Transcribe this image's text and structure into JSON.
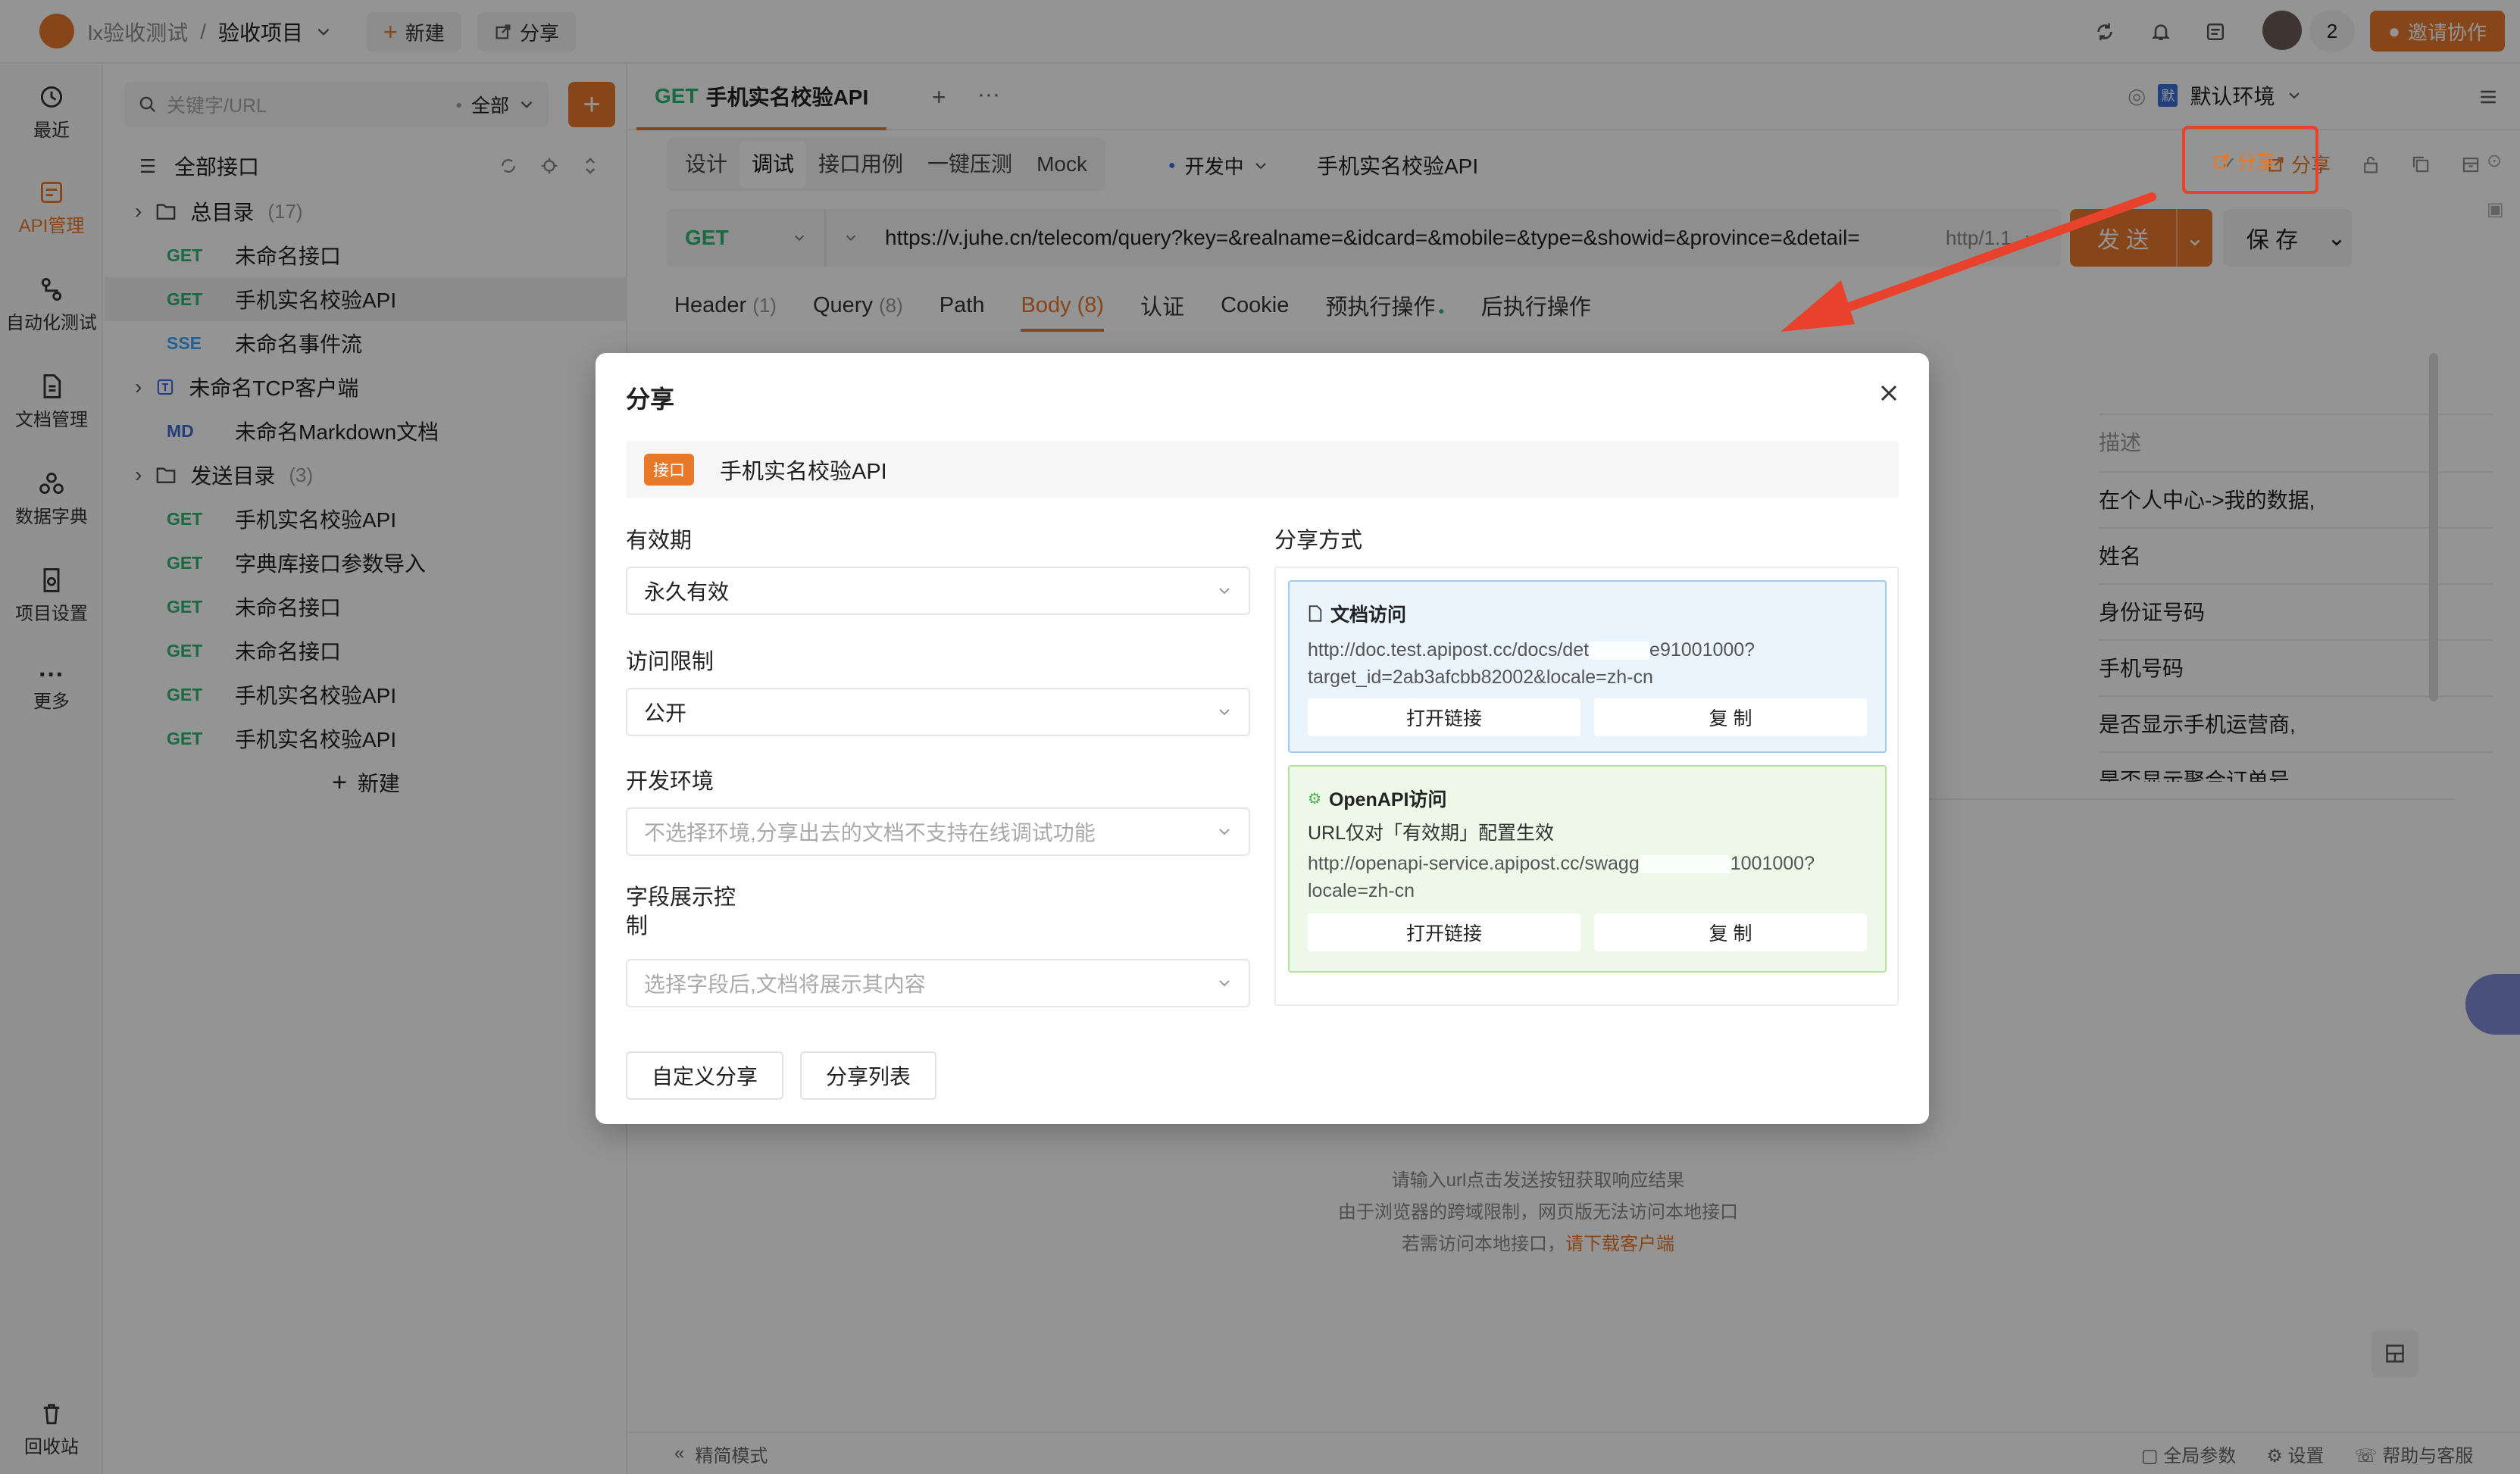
{
  "topbar": {
    "project_group": "lx验收测试",
    "separator": "/",
    "project": "验收项目",
    "new_label": "新建",
    "share_label": "分享",
    "member_count": "2",
    "invite_label": "邀请协作"
  },
  "rail": [
    {
      "label": "最近"
    },
    {
      "label": "API管理"
    },
    {
      "label": "自动化测试"
    },
    {
      "label": "文档管理"
    },
    {
      "label": "数据字典"
    },
    {
      "label": "项目设置"
    },
    {
      "label": "更多"
    },
    {
      "label": "回收站"
    }
  ],
  "tree": {
    "search_placeholder": "关键字/URL",
    "filter": "全部",
    "root": "全部接口",
    "items": [
      {
        "type": "folder",
        "name": "总目录",
        "count": "(17)"
      },
      {
        "method": "GET",
        "name": "未命名接口"
      },
      {
        "method": "GET",
        "name": "手机实名校验API"
      },
      {
        "method": "SSE",
        "name": "未命名事件流"
      },
      {
        "type": "tcp",
        "name": "未命名TCP客户端"
      },
      {
        "method": "MD",
        "name": "未命名Markdown文档"
      },
      {
        "type": "folder",
        "name": "发送目录",
        "count": "(3)"
      },
      {
        "method": "GET",
        "name": "手机实名校验API"
      },
      {
        "method": "GET",
        "name": "字典库接口参数导入"
      },
      {
        "method": "GET",
        "name": "未命名接口"
      },
      {
        "method": "GET",
        "name": "未命名接口"
      },
      {
        "method": "GET",
        "name": "手机实名校验API"
      },
      {
        "method": "GET",
        "name": "手机实名校验API"
      }
    ],
    "new_label": "新建"
  },
  "tab": {
    "method": "GET",
    "title": "手机实名校验API",
    "env": "默认环境"
  },
  "subtabs": [
    "设计",
    "调试",
    "接口用例",
    "一键压测",
    "Mock"
  ],
  "status": "开发中",
  "api_name": "手机实名校验API",
  "share_top": "分享",
  "request": {
    "method": "GET",
    "url": "https://v.juhe.cn/telecom/query?key=&realname=&idcard=&mobile=&type=&showid=&province=&detail=",
    "protocol": "http/1.1",
    "send": "发 送",
    "save": "保 存"
  },
  "req_tabs": [
    {
      "label": "Header",
      "count": "(1)"
    },
    {
      "label": "Query",
      "count": "(8)"
    },
    {
      "label": "Path",
      "count": ""
    },
    {
      "label": "Body",
      "count": "(8)"
    },
    {
      "label": "认证",
      "count": ""
    },
    {
      "label": "Cookie",
      "count": ""
    },
    {
      "label": "预执行操作",
      "count": ""
    },
    {
      "label": "后执行操作",
      "count": ""
    }
  ],
  "desc_header": "描述",
  "descriptions": [
    "在个人中心->我的数据,",
    "姓名",
    "身份证号码",
    "手机号码",
    "是否显示手机运营商,",
    "是否显示聚合订单号"
  ],
  "hint": {
    "line1": "请输入url点击发送按钮获取响应结果",
    "line2": "由于浏览器的跨域限制，网页版无法访问本地接口",
    "line3_prefix": "若需访问本地接口，",
    "line3_link": "请下载客户端"
  },
  "footer": {
    "simple_mode": "精简模式",
    "global_params": "全局参数",
    "settings": "设置",
    "help": "帮助与客服"
  },
  "dialog": {
    "title": "分享",
    "badge": "接口",
    "api_name": "手机实名校验API",
    "validity_label": "有效期",
    "validity_value": "永久有效",
    "access_label": "访问限制",
    "access_value": "公开",
    "env_label": "开发环境",
    "env_placeholder": "不选择环境,分享出去的文档不支持在线调试功能",
    "field_label": "字段展示控制",
    "field_placeholder": "选择字段后,文档将展示其内容",
    "method_label": "分享方式",
    "doc_title": "文档访问",
    "doc_url_1": "http://doc.test.apipost.cc/docs/det",
    "doc_url_1b": "e91001000?",
    "doc_url_2": "target_id=2ab3afcbb82002&locale=zh-cn",
    "open_link": "打开链接",
    "copy": "复 制",
    "openapi_title": "OpenAPI访问",
    "openapi_note": "URL仅对「有效期」配置生效",
    "openapi_url_1": "http://openapi-service.apipost.cc/swagg",
    "openapi_url_1b": "1001000?",
    "openapi_url_2": "locale=zh-cn",
    "custom_share": "自定义分享",
    "share_list": "分享列表"
  },
  "colors": {
    "accent": "#e8792b",
    "doc_bg": "#eaf4fd",
    "openapi_bg": "#eef8e8",
    "annotation": "#e8412c"
  }
}
